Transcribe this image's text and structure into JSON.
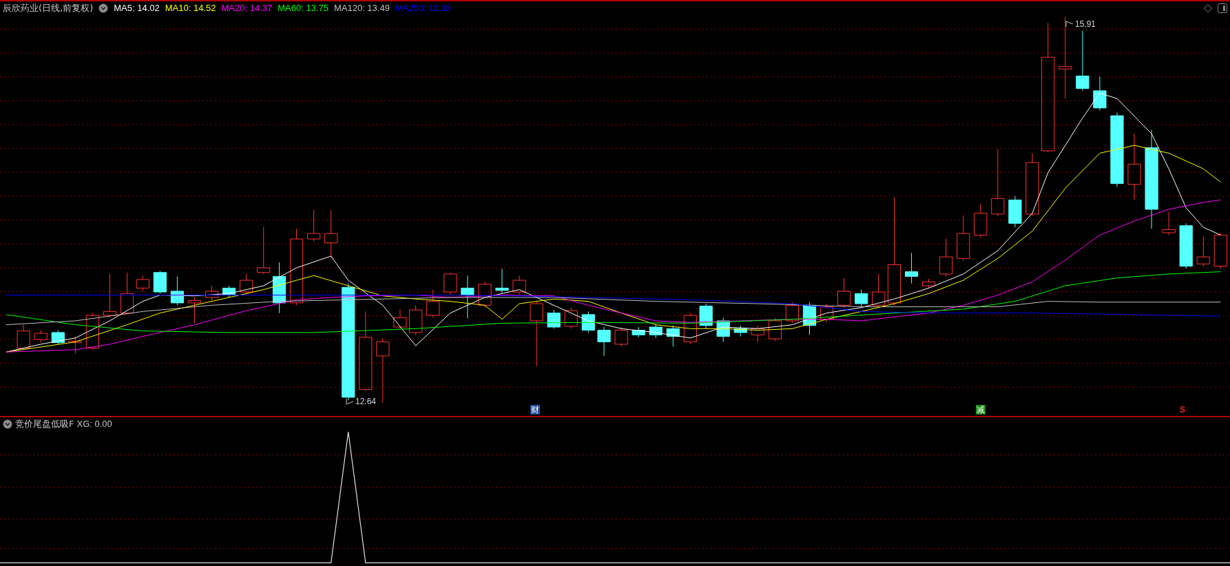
{
  "header": {
    "title": "辰欣药业(日线,前复权)",
    "indicators": [
      {
        "label": "MA5: 14.02",
        "color": "#ffffff"
      },
      {
        "label": "MA10: 14.52",
        "color": "#ffff00"
      },
      {
        "label": "MA20: 14.37",
        "color": "#ff00ff"
      },
      {
        "label": "MA60: 13.75",
        "color": "#00ff00"
      },
      {
        "label": "MA120: 13.49",
        "color": "#c0c0c0"
      },
      {
        "label": "MA250: 13.38",
        "color": "#0000ff"
      }
    ]
  },
  "chart": {
    "high_label": "15.91",
    "low_label": "12.64",
    "events": [
      {
        "kind": "badge",
        "text": "财",
        "color": "#1e4d9b"
      },
      {
        "kind": "badge",
        "text": "减",
        "color": "#1a8a1a"
      },
      {
        "kind": "signal",
        "text": "S",
        "color": "#ff2020"
      }
    ]
  },
  "sub_panel": {
    "title": "竞价尾盘低吸F",
    "readout": "XG: 0.00"
  }
}
